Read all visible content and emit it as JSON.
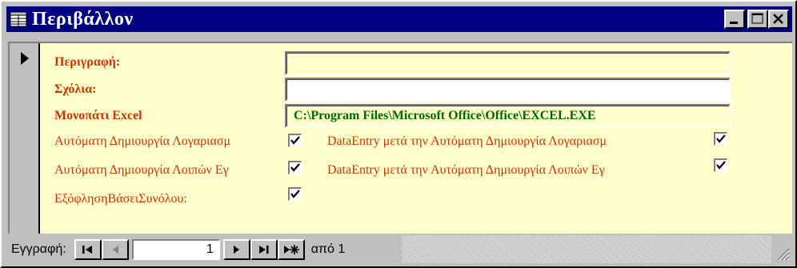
{
  "window": {
    "title": "Περιβάλλον"
  },
  "fields": {
    "description": {
      "label": "Περιγραφή:",
      "value": ""
    },
    "comments": {
      "label": "Σχόλια:",
      "value": ""
    },
    "excel_path": {
      "label": "Μονοπάτι Excel",
      "value": "C:\\Program Files\\Microsoft Office\\Office\\EXCEL.EXE"
    }
  },
  "checkboxes": {
    "auto_create_accounts": {
      "label": "Αυτόματη Δημιουργία Λογαριασμ",
      "checked": true
    },
    "auto_create_other": {
      "label": "Αυτόματη Δημιουργία Λοιπών Εγ",
      "checked": true
    },
    "settlement_by_total": {
      "label": "ΕξόφλησηΒάσειΣυνόλου:",
      "checked": true
    },
    "dataentry_after_accounts": {
      "label": "DataEntry μετά την Αυτόματη Δημιουργία Λογαριασμ",
      "checked": true
    },
    "dataentry_after_other": {
      "label": "DataEntry μετά την Αυτόματη Δημιουργία Λοιπών Εγ",
      "checked": true
    }
  },
  "navigator": {
    "label": "Εγγραφή:",
    "current_record": "1",
    "of_text": "από 1"
  },
  "colors": {
    "title_bar": "#000080",
    "form_bg": "#ffffcc",
    "label_text": "#cc3300",
    "field_text": "#006600"
  },
  "icons": {
    "title": "form-datasheet-icon",
    "record_selector": "current-record-arrow-icon"
  }
}
